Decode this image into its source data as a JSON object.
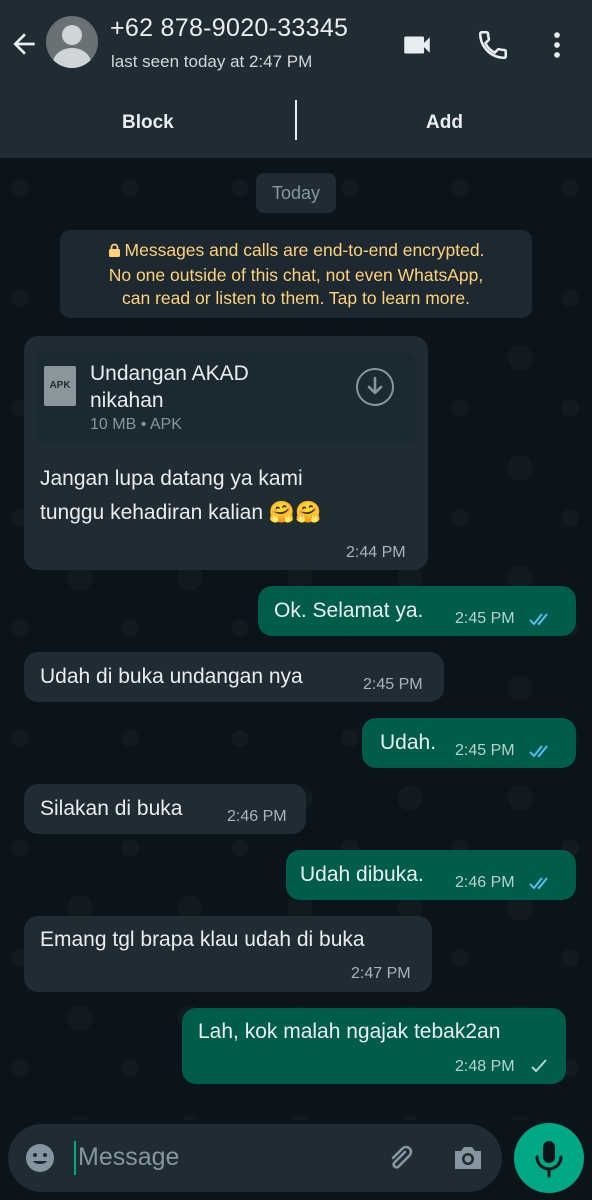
{
  "header": {
    "contact": "+62 878-9020-33345",
    "status": "last seen today at 2:47 PM",
    "back_icon": "arrow-left-icon",
    "video_icon": "video-call-icon",
    "call_icon": "phone-icon",
    "menu_icon": "more-vert-icon"
  },
  "actions": {
    "block": "Block",
    "add": "Add"
  },
  "date_chip": "Today",
  "encryption": {
    "line1": "Messages and calls are end-to-end encrypted.",
    "line2": "No one outside of this chat, not even WhatsApp,",
    "line3": "can read or listen to them. Tap to learn more."
  },
  "file": {
    "icon_label": "APK",
    "name_line1": "Undangan AKAD",
    "name_line2": "nikahan",
    "meta": "10 MB • APK"
  },
  "messages": [
    {
      "dir": "in",
      "line1": "Jangan lupa datang ya kami",
      "line2": "tunggu kehadiran kalian 🤗🤗",
      "time": "2:44 PM"
    },
    {
      "dir": "out",
      "text": "Ok. Selamat ya.",
      "time": "2:45 PM",
      "status": "read"
    },
    {
      "dir": "in",
      "text": "Udah di buka undangan nya",
      "time": "2:45 PM"
    },
    {
      "dir": "out",
      "text": "Udah.",
      "time": "2:45 PM",
      "status": "read"
    },
    {
      "dir": "in",
      "text": "Silakan di buka",
      "time": "2:46 PM"
    },
    {
      "dir": "out",
      "text": "Udah dibuka.",
      "time": "2:46 PM",
      "status": "read"
    },
    {
      "dir": "in",
      "text": "Emang tgl brapa klau udah di buka",
      "time": "2:47 PM"
    },
    {
      "dir": "out",
      "text": "Lah, kok malah ngajak tebak2an",
      "time": "2:48 PM",
      "status": "sent"
    }
  ],
  "input": {
    "placeholder": "Message",
    "emoji_icon": "emoji-icon",
    "attach_icon": "paperclip-icon",
    "camera_icon": "camera-icon",
    "mic_icon": "mic-icon"
  },
  "colors": {
    "incoming_bubble": "#1f2c34",
    "outgoing_bubble": "#005c4b",
    "accent": "#00a884",
    "read_ticks": "#53bdeb",
    "encryption_text": "#ffd279"
  }
}
